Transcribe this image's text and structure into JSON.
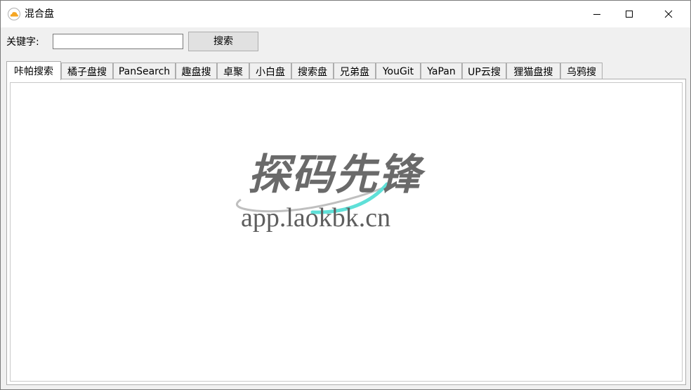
{
  "window": {
    "title": "混合盘",
    "icon": "cloud-app-icon"
  },
  "search": {
    "label": "关键字:",
    "value": "",
    "placeholder": "",
    "button_label": "搜索"
  },
  "tabs": [
    {
      "label": "咔帕搜索",
      "active": true
    },
    {
      "label": "橘子盘搜",
      "active": false
    },
    {
      "label": "PanSearch",
      "active": false
    },
    {
      "label": "趣盘搜",
      "active": false
    },
    {
      "label": "卓聚",
      "active": false
    },
    {
      "label": "小白盘",
      "active": false
    },
    {
      "label": "搜索盘",
      "active": false
    },
    {
      "label": "兄弟盘",
      "active": false
    },
    {
      "label": "YouGit",
      "active": false
    },
    {
      "label": "YaPan",
      "active": false
    },
    {
      "label": "UP云搜",
      "active": false
    },
    {
      "label": "狸猫盘搜",
      "active": false
    },
    {
      "label": "乌鸦搜",
      "active": false
    }
  ],
  "watermark": {
    "title": "探码先锋",
    "url": "app.laokbk.cn"
  },
  "colors": {
    "accent_orange": "#f5a623",
    "watermark_gray": "#6a6a6a",
    "swoosh_cyan": "#5fe0d8"
  }
}
